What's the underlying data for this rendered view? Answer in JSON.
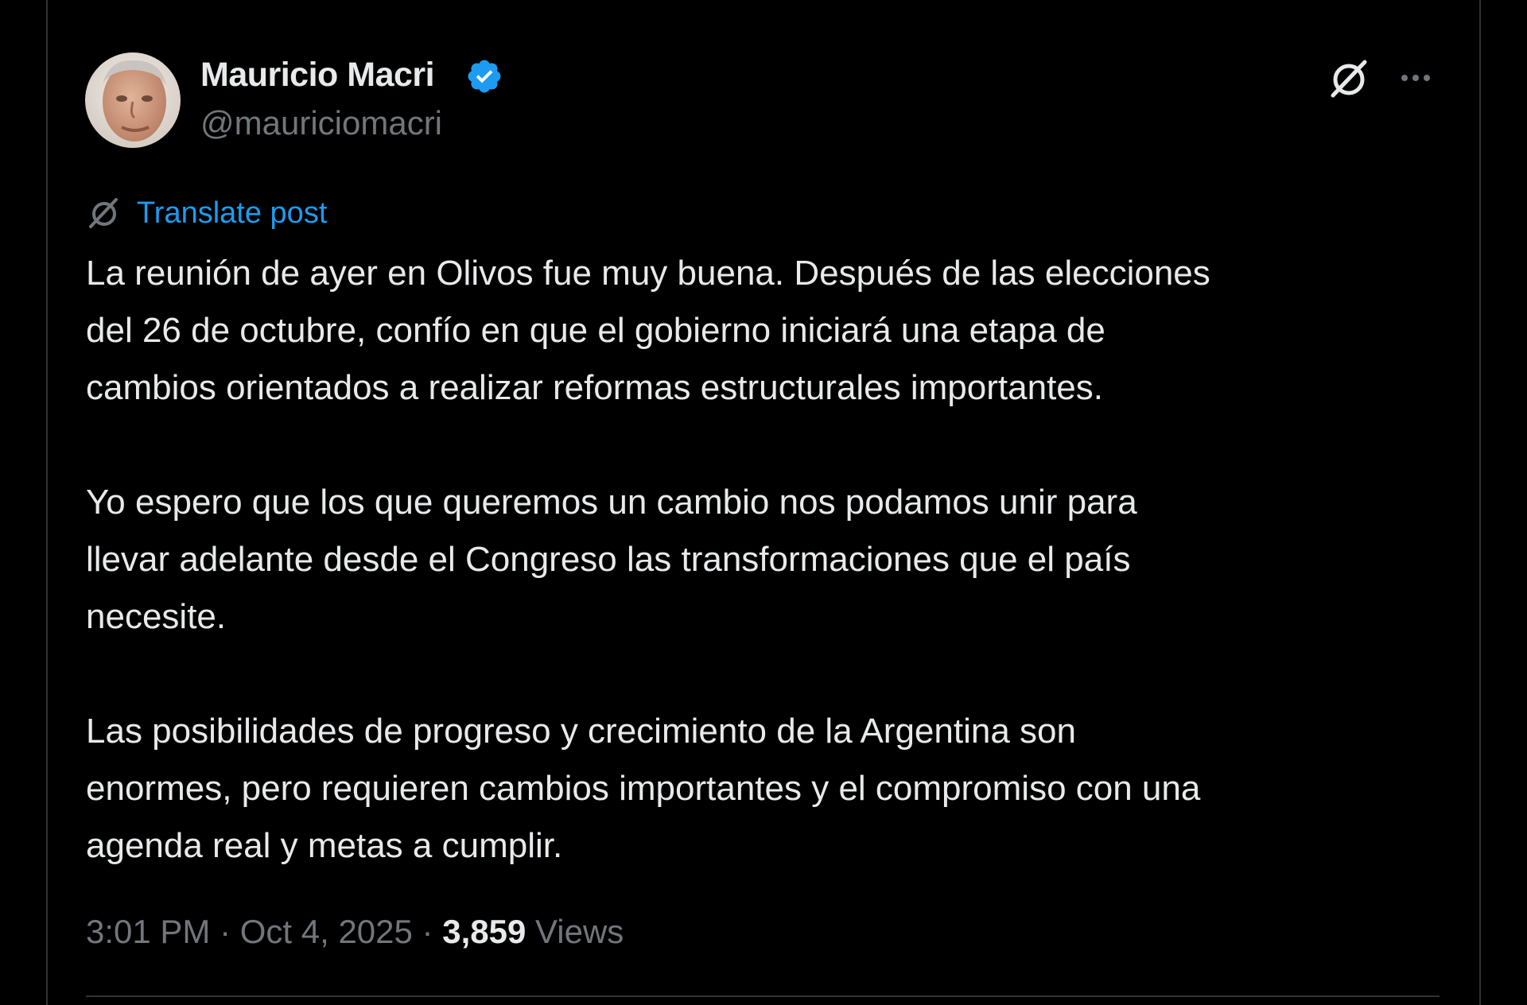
{
  "post": {
    "author": {
      "name": "Mauricio Macri",
      "handle": "@mauriciomacri",
      "verified": true
    },
    "actions": {
      "grok_icon": "grok-icon",
      "more_icon": "more-icon"
    },
    "translate_label": "Translate post",
    "paragraphs": [
      {
        "lines": [
          "La reunión de ayer en Olivos fue muy buena. Después de las elecciones",
          "del 26 de octubre, confío en que el gobierno iniciará una etapa de",
          "cambios orientados a realizar reformas estructurales importantes."
        ]
      },
      {
        "lines": [
          "Yo espero que los que queremos un cambio nos podamos unir para",
          "llevar adelante desde el Congreso las transformaciones que el país",
          "necesite."
        ]
      },
      {
        "lines": [
          "Las posibilidades de progreso y crecimiento de la Argentina son",
          "enormes, pero requieren cambios importantes y el compromiso con una",
          "agenda real y metas a cumplir."
        ]
      }
    ],
    "meta": {
      "time": "3:01 PM",
      "separator": " · ",
      "date": "Oct 4, 2025",
      "views_count": "3,859",
      "views_label": "Views"
    }
  },
  "colors": {
    "background": "#000000",
    "text_primary": "#e7e9ea",
    "text_secondary": "#71767b",
    "accent": "#1d9bf0",
    "border": "#2f3336"
  }
}
